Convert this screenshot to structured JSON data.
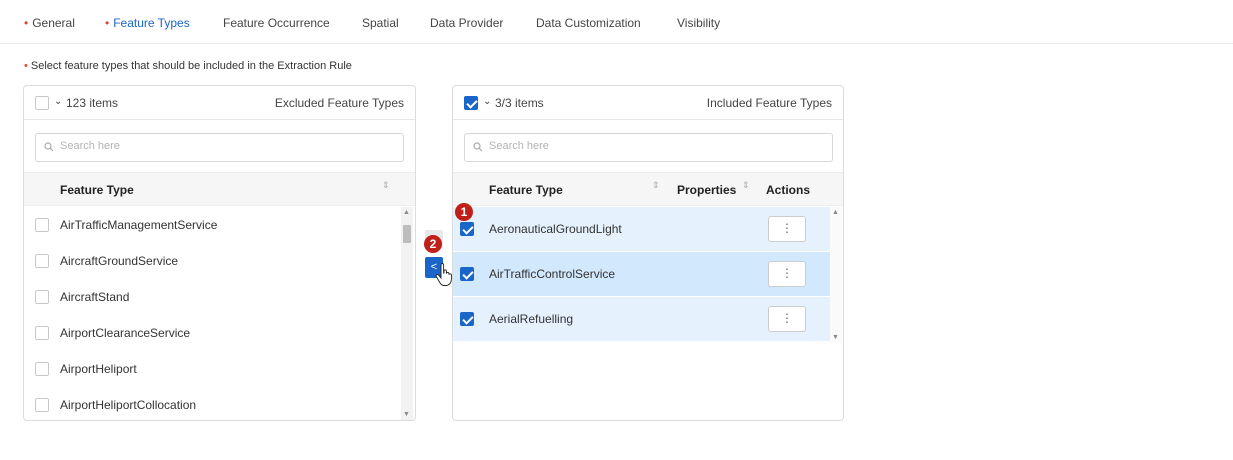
{
  "tabs": [
    {
      "label": "General",
      "required": true,
      "active": false
    },
    {
      "label": "Feature Types",
      "required": true,
      "active": true
    },
    {
      "label": "Feature Occurrence",
      "required": false,
      "active": false
    },
    {
      "label": "Spatial",
      "required": false,
      "active": false
    },
    {
      "label": "Data Provider",
      "required": false,
      "active": false
    },
    {
      "label": "Data Customization",
      "required": false,
      "active": false
    },
    {
      "label": "Visibility",
      "required": false,
      "active": false
    }
  ],
  "required_marker": "•",
  "instruction": "Select feature types that should be included in the Extraction Rule",
  "left_panel": {
    "count": "123 items",
    "title": "Excluded Feature Types",
    "search_placeholder": "Search here",
    "column_header": "Feature Type",
    "rows": [
      "AirTrafficManagementService",
      "AircraftGroundService",
      "AircraftStand",
      "AirportClearanceService",
      "AirportHeliport",
      "AirportHeliportCollocation"
    ]
  },
  "right_panel": {
    "count": "3/3 items",
    "title": "Included Feature Types",
    "search_placeholder": "Search here",
    "column_headers": {
      "feature_type": "Feature Type",
      "properties": "Properties",
      "actions": "Actions"
    },
    "rows": [
      {
        "label": "AeronauticalGroundLight",
        "checked": true
      },
      {
        "label": "AirTrafficControlService",
        "checked": true
      },
      {
        "label": "AerialRefuelling",
        "checked": true
      }
    ],
    "action_glyph": "⋮"
  },
  "move_button_glyph": "<",
  "badges": {
    "one": "1",
    "two": "2"
  },
  "icons": {
    "caret": "⌄",
    "sort": "⇕",
    "search": "search-icon"
  },
  "colors": {
    "accent": "#1a66c8",
    "required": "#e0453a",
    "row_selected": "#e5f2fe",
    "badge": "#c0201a"
  }
}
